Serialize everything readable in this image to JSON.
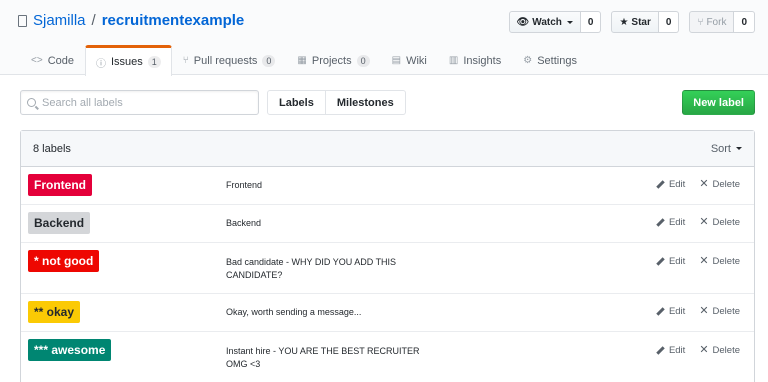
{
  "repo": {
    "owner": "Sjamilla",
    "separator": "/",
    "name": "recruitmentexample"
  },
  "actions": {
    "watch": {
      "label": "Watch",
      "count": "0"
    },
    "star": {
      "label": "Star",
      "count": "0"
    },
    "fork": {
      "label": "Fork",
      "count": "0"
    }
  },
  "tabs": [
    {
      "icon": "code-icon",
      "glyph": "<>",
      "label": "Code",
      "counter": ""
    },
    {
      "icon": "issue-icon",
      "glyph": "ⓘ",
      "label": "Issues",
      "counter": "1"
    },
    {
      "icon": "pull-request-icon",
      "glyph": "⑂",
      "label": "Pull requests",
      "counter": "0"
    },
    {
      "icon": "project-icon",
      "glyph": "▦",
      "label": "Projects",
      "counter": "0"
    },
    {
      "icon": "wiki-icon",
      "glyph": "▤",
      "label": "Wiki",
      "counter": ""
    },
    {
      "icon": "graph-icon",
      "glyph": "▥",
      "label": "Insights",
      "counter": ""
    },
    {
      "icon": "gear-icon",
      "glyph": "⚙",
      "label": "Settings",
      "counter": ""
    }
  ],
  "search": {
    "placeholder": "Search all labels",
    "value": ""
  },
  "subnav": {
    "labels": "Labels",
    "milestones": "Milestones"
  },
  "new_label": "New label",
  "box": {
    "count_text": "8 labels",
    "sort": "Sort"
  },
  "row_actions": {
    "edit": "Edit",
    "delete": "Delete"
  },
  "labels": [
    {
      "name": "Frontend",
      "description": "Frontend",
      "color": "#e4003a",
      "text_color": "#ffffff"
    },
    {
      "name": "Backend",
      "description": "Backend",
      "color": "#d4d6d9",
      "text_color": "#24292e"
    },
    {
      "name": "* not good",
      "description": "Bad candidate - WHY DID YOU ADD THIS CANDIDATE?",
      "color": "#ee0701",
      "text_color": "#ffffff"
    },
    {
      "name": "** okay",
      "description": "Okay, worth sending a message...",
      "color": "#fbca04",
      "text_color": "#24292e"
    },
    {
      "name": "*** awesome",
      "description": "Instant hire - YOU ARE THE BEST RECRUITER OMG <3",
      "color": "#008672",
      "text_color": "#ffffff"
    }
  ]
}
